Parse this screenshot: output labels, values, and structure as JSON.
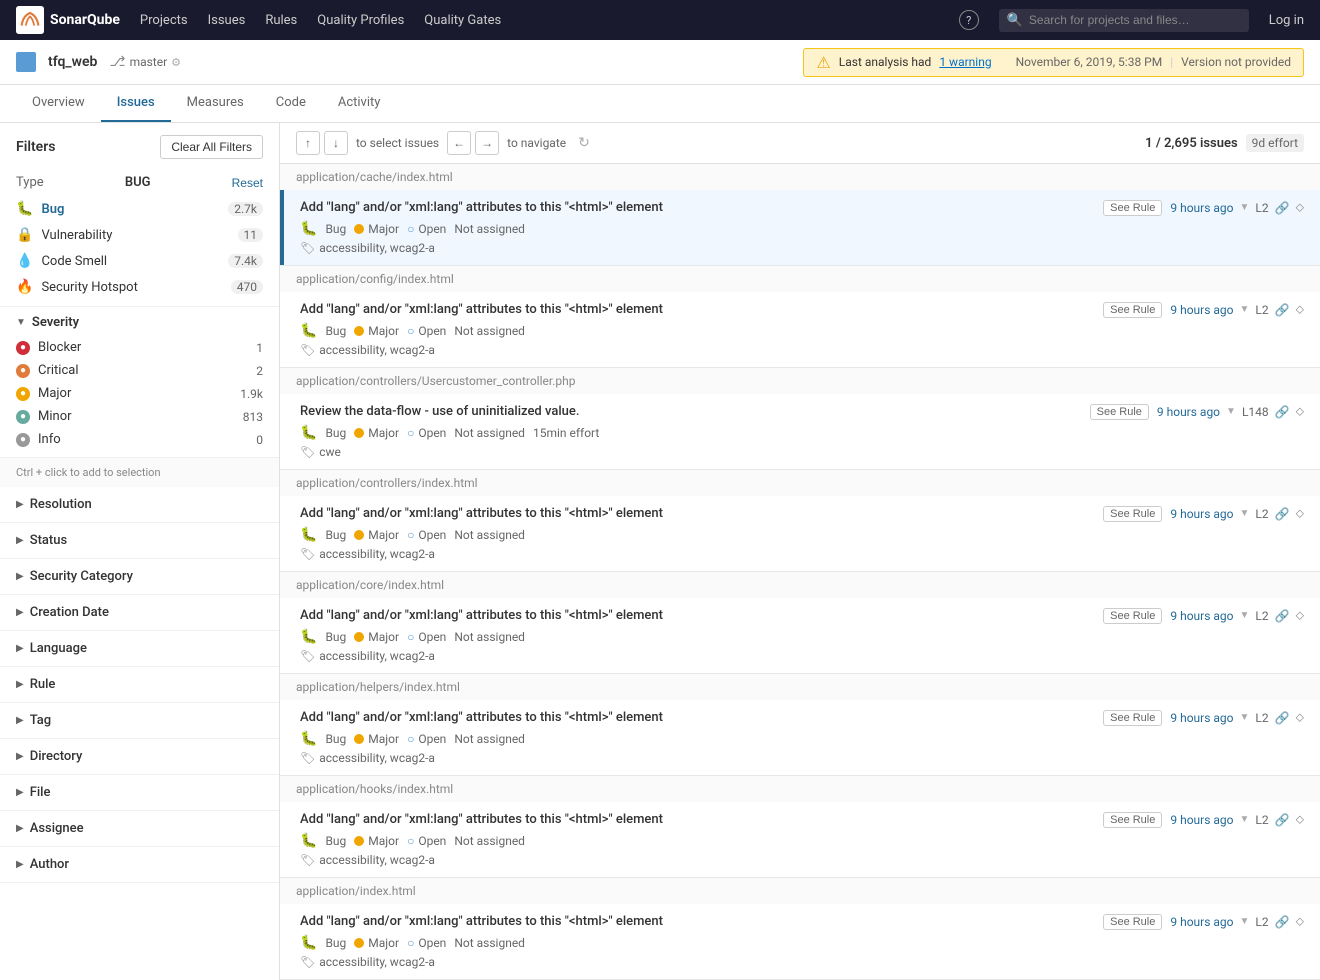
{
  "topnav": {
    "logo_alt": "SonarQube",
    "links": [
      "Projects",
      "Issues",
      "Rules",
      "Quality Profiles",
      "Quality Gates"
    ],
    "search_placeholder": "Search for projects and files…",
    "login_label": "Log in",
    "help_label": "?"
  },
  "project_header": {
    "project_name": "tfq_web",
    "branch": "master",
    "warning_text": "Last analysis had",
    "warning_count": "1 warning",
    "warning_date": "November 6, 2019, 5:38 PM",
    "warning_version": "Version not provided"
  },
  "tabs": [
    {
      "label": "Overview",
      "active": false
    },
    {
      "label": "Issues",
      "active": true
    },
    {
      "label": "Measures",
      "active": false
    },
    {
      "label": "Code",
      "active": false
    },
    {
      "label": "Activity",
      "active": false
    }
  ],
  "sidebar": {
    "filters_title": "Filters",
    "clear_all_label": "Clear All Filters",
    "type_section": {
      "label": "Type",
      "value": "BUG",
      "reset_label": "Reset",
      "options": [
        {
          "icon": "🐛",
          "label": "Bug",
          "count": "2.7k",
          "active": true
        },
        {
          "icon": "🔒",
          "label": "Vulnerability",
          "count": "11",
          "active": false
        },
        {
          "icon": "💧",
          "label": "Code Smell",
          "count": "7.4k",
          "active": false
        },
        {
          "icon": "🔥",
          "label": "Security Hotspot",
          "count": "470",
          "active": false
        }
      ]
    },
    "severity_section": {
      "label": "Severity",
      "items": [
        {
          "level": "Blocker",
          "count": "1",
          "color": "blocker"
        },
        {
          "level": "Critical",
          "count": "2",
          "color": "critical"
        },
        {
          "level": "Major",
          "count": "1.9k",
          "color": "major"
        },
        {
          "level": "Minor",
          "count": "813",
          "color": "minor"
        },
        {
          "level": "Info",
          "count": "0",
          "color": "info"
        }
      ]
    },
    "collapsible_sections": [
      "Resolution",
      "Status",
      "Security Category",
      "Creation Date",
      "Language",
      "Rule",
      "Tag",
      "Directory",
      "File",
      "Assignee",
      "Author"
    ],
    "ctrl_hint": "Ctrl + click to add to selection"
  },
  "toolbar": {
    "up_arrow": "↑",
    "down_arrow": "↓",
    "select_hint": "to select issues",
    "left_arrow": "←",
    "right_arrow": "→",
    "navigate_hint": "to navigate",
    "count_label": "1 / 2,695 issues",
    "effort_label": "9d effort"
  },
  "issues": [
    {
      "path": "application/cache/index.html",
      "title": "Add \"lang\" and/or \"xml:lang\" attributes to this \"<html>\" element",
      "see_rule": "See Rule",
      "type_icon": "🐛",
      "type": "Bug",
      "severity": "Major",
      "status": "Open",
      "assigned": "Not assigned",
      "time": "9 hours ago",
      "line": "L2",
      "tags": "accessibility, wcag2-a",
      "selected": true
    },
    {
      "path": "application/config/index.html",
      "title": "Add \"lang\" and/or \"xml:lang\" attributes to this \"<html>\" element",
      "see_rule": "See Rule",
      "type_icon": "🐛",
      "type": "Bug",
      "severity": "Major",
      "status": "Open",
      "assigned": "Not assigned",
      "time": "9 hours ago",
      "line": "L2",
      "tags": "accessibility, wcag2-a",
      "selected": false
    },
    {
      "path": "application/controllers/Usercustomer_controller.php",
      "title": "Review the data-flow - use of uninitialized value.",
      "see_rule": "See Rule",
      "type_icon": "🐛",
      "type": "Bug",
      "severity": "Major",
      "status": "Open",
      "assigned": "Not assigned",
      "effort": "15min effort",
      "time": "9 hours ago",
      "line": "L148",
      "tags": "cwe",
      "selected": false
    },
    {
      "path": "application/controllers/index.html",
      "title": "Add \"lang\" and/or \"xml:lang\" attributes to this \"<html>\" element",
      "see_rule": "See Rule",
      "type_icon": "🐛",
      "type": "Bug",
      "severity": "Major",
      "status": "Open",
      "assigned": "Not assigned",
      "time": "9 hours ago",
      "line": "L2",
      "tags": "accessibility, wcag2-a",
      "selected": false
    },
    {
      "path": "application/core/index.html",
      "title": "Add \"lang\" and/or \"xml:lang\" attributes to this \"<html>\" element",
      "see_rule": "See Rule",
      "type_icon": "🐛",
      "type": "Bug",
      "severity": "Major",
      "status": "Open",
      "assigned": "Not assigned",
      "time": "9 hours ago",
      "line": "L2",
      "tags": "accessibility, wcag2-a",
      "selected": false
    },
    {
      "path": "application/helpers/index.html",
      "title": "Add \"lang\" and/or \"xml:lang\" attributes to this \"<html>\" element",
      "see_rule": "See Rule",
      "type_icon": "🐛",
      "type": "Bug",
      "severity": "Major",
      "status": "Open",
      "assigned": "Not assigned",
      "time": "9 hours ago",
      "line": "L2",
      "tags": "accessibility, wcag2-a",
      "selected": false
    },
    {
      "path": "application/hooks/index.html",
      "title": "Add \"lang\" and/or \"xml:lang\" attributes to this \"<html>\" element",
      "see_rule": "See Rule",
      "type_icon": "🐛",
      "type": "Bug",
      "severity": "Major",
      "status": "Open",
      "assigned": "Not assigned",
      "time": "9 hours ago",
      "line": "L2",
      "tags": "accessibility, wcag2-a",
      "selected": false
    },
    {
      "path": "application/index.html",
      "title": "Add \"lang\" and/or \"xml:lang\" attributes to this \"<html>\" element",
      "see_rule": "See Rule",
      "type_icon": "🐛",
      "type": "Bug",
      "severity": "Major",
      "status": "Open",
      "assigned": "Not assigned",
      "time": "9 hours ago",
      "line": "L2",
      "tags": "accessibility, wcag2-a",
      "selected": false
    }
  ]
}
